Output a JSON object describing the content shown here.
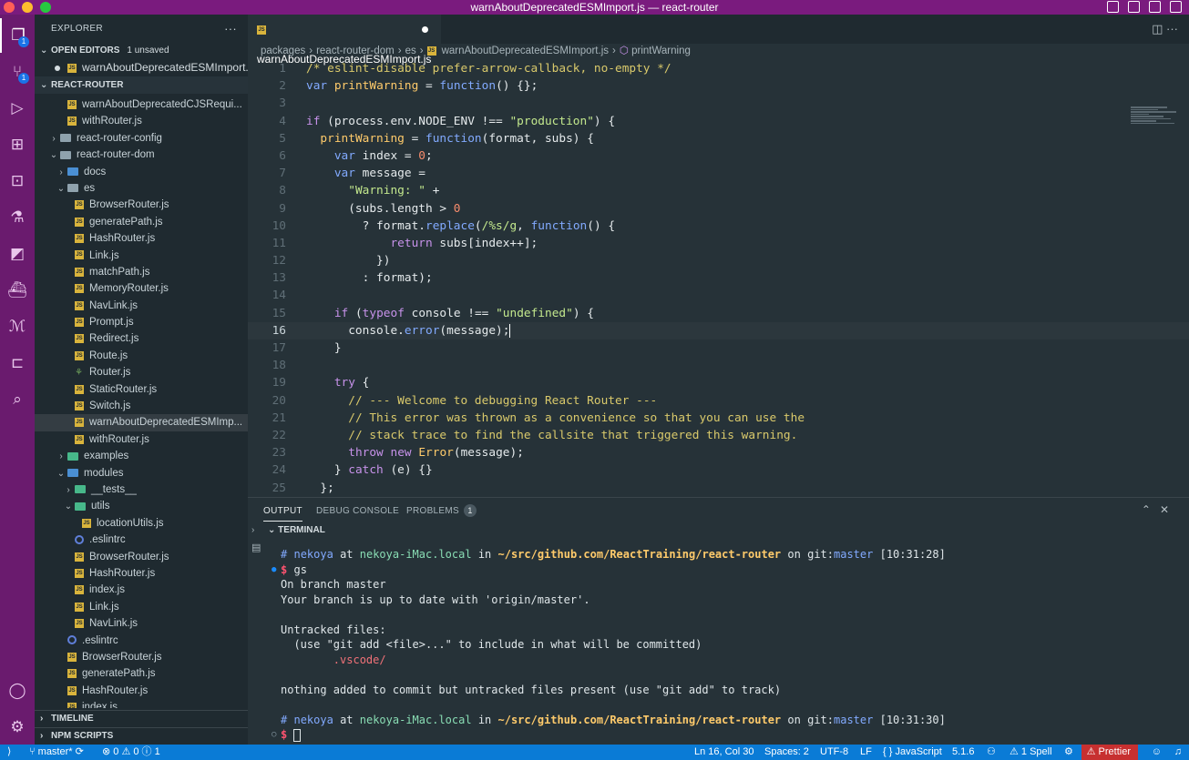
{
  "window": {
    "title": "warnAboutDeprecatedESMImport.js — react-router"
  },
  "sidebar": {
    "header": "EXPLORER",
    "open_editors": {
      "label": "OPEN EDITORS",
      "unsaved": "1 unsaved",
      "items": [
        "warnAboutDeprecatedESMImport..."
      ]
    },
    "project": "REACT-ROUTER",
    "tree": [
      {
        "label": "warnAboutDeprecatedCJSRequi...",
        "icon": "js",
        "depth": 2
      },
      {
        "label": "withRouter.js",
        "icon": "js",
        "depth": 2
      },
      {
        "label": "react-router-config",
        "icon": "folder",
        "depth": 1,
        "chev": "›"
      },
      {
        "label": "react-router-dom",
        "icon": "folder",
        "depth": 1,
        "chev": "⌄"
      },
      {
        "label": "docs",
        "icon": "folder-blue",
        "depth": 2,
        "chev": "›"
      },
      {
        "label": "es",
        "icon": "folder",
        "depth": 2,
        "chev": "⌄"
      },
      {
        "label": "BrowserRouter.js",
        "icon": "js",
        "depth": 3
      },
      {
        "label": "generatePath.js",
        "icon": "js",
        "depth": 3
      },
      {
        "label": "HashRouter.js",
        "icon": "js",
        "depth": 3
      },
      {
        "label": "Link.js",
        "icon": "js",
        "depth": 3
      },
      {
        "label": "matchPath.js",
        "icon": "js",
        "depth": 3
      },
      {
        "label": "MemoryRouter.js",
        "icon": "js",
        "depth": 3
      },
      {
        "label": "NavLink.js",
        "icon": "js",
        "depth": 3
      },
      {
        "label": "Prompt.js",
        "icon": "js",
        "depth": 3
      },
      {
        "label": "Redirect.js",
        "icon": "js",
        "depth": 3
      },
      {
        "label": "Route.js",
        "icon": "js",
        "depth": 3
      },
      {
        "label": "Router.js",
        "icon": "leaf",
        "depth": 3
      },
      {
        "label": "StaticRouter.js",
        "icon": "js",
        "depth": 3
      },
      {
        "label": "Switch.js",
        "icon": "js",
        "depth": 3
      },
      {
        "label": "warnAboutDeprecatedESMImp...",
        "icon": "js",
        "depth": 3,
        "selected": true
      },
      {
        "label": "withRouter.js",
        "icon": "js",
        "depth": 3
      },
      {
        "label": "examples",
        "icon": "folder-green",
        "depth": 2,
        "chev": "›"
      },
      {
        "label": "modules",
        "icon": "folder-blue",
        "depth": 2,
        "chev": "⌄"
      },
      {
        "label": "__tests__",
        "icon": "folder-green",
        "depth": 3,
        "chev": "›"
      },
      {
        "label": "utils",
        "icon": "folder-green",
        "depth": 3,
        "chev": "⌄"
      },
      {
        "label": "locationUtils.js",
        "icon": "js",
        "depth": 4
      },
      {
        "label": ".eslintrc",
        "icon": "dot",
        "depth": 3
      },
      {
        "label": "BrowserRouter.js",
        "icon": "js",
        "depth": 3
      },
      {
        "label": "HashRouter.js",
        "icon": "js",
        "depth": 3
      },
      {
        "label": "index.js",
        "icon": "js",
        "depth": 3
      },
      {
        "label": "Link.js",
        "icon": "js",
        "depth": 3
      },
      {
        "label": "NavLink.js",
        "icon": "js",
        "depth": 3
      },
      {
        "label": ".eslintrc",
        "icon": "dot",
        "depth": 2
      },
      {
        "label": "BrowserRouter.js",
        "icon": "js",
        "depth": 2
      },
      {
        "label": "generatePath.js",
        "icon": "js",
        "depth": 2
      },
      {
        "label": "HashRouter.js",
        "icon": "js",
        "depth": 2
      },
      {
        "label": "index.js",
        "icon": "js",
        "depth": 2
      }
    ],
    "timeline": "TIMELINE",
    "npm_scripts": "NPM SCRIPTS"
  },
  "editor": {
    "tab_label": "warnAboutDeprecatedESMImport.js",
    "breadcrumb": [
      "packages",
      "react-router-dom",
      "es",
      "warnAboutDeprecatedESMImport.js",
      "printWarning"
    ],
    "current_line": 16
  },
  "panel": {
    "tabs": [
      "OUTPUT",
      "DEBUG CONSOLE",
      "PROBLEMS"
    ],
    "problems_count": "1",
    "terminal_label": "TERMINAL"
  },
  "terminal": {
    "prompt1": {
      "user": "nekoya",
      "host": "nekoya-iMac.local",
      "path": "~/src/github.com/ReactTraining/react-router",
      "branch": "master",
      "time": "[10:31:28]"
    },
    "command": "gs",
    "output": [
      "On branch master",
      "Your branch is up to date with 'origin/master'.",
      "",
      "Untracked files:",
      "  (use \"git add <file>...\" to include in what will be committed)"
    ],
    "untracked": "        .vscode/",
    "footer": "nothing added to commit but untracked files present (use \"git add\" to track)",
    "prompt2": {
      "user": "nekoya",
      "host": "nekoya-iMac.local",
      "path": "~/src/github.com/ReactTraining/react-router",
      "branch": "master",
      "time": "[10:31:30]"
    },
    "word_at": "at",
    "word_in": "in",
    "word_on": "on",
    "word_git": "git:"
  },
  "statusbar": {
    "branch": "master*",
    "problems": "⊗ 0 ⚠ 0 ⓘ 1",
    "position": "Ln 16, Col 30",
    "spaces": "Spaces: 2",
    "encoding": "UTF-8",
    "eol": "LF",
    "language": "JavaScript",
    "version": "5.1.6",
    "spell": "1 Spell",
    "prettier": "Prettier"
  },
  "colors": {
    "titlebar": "#7a1b7e",
    "activitybar": "#6a1b6e",
    "statusbar": "#0a7bd6",
    "editor_bg": "#263238",
    "sidebar_bg": "#1f2a30"
  }
}
